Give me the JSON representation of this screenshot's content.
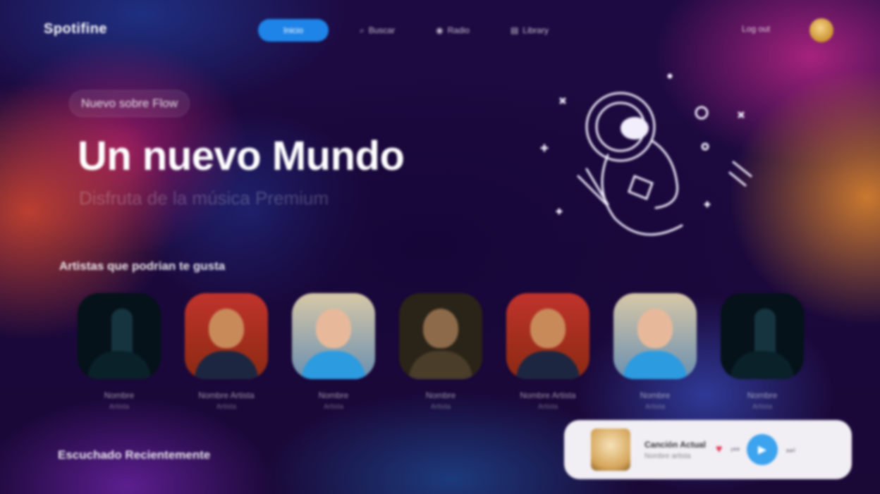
{
  "brand": {
    "logo": "Spotifine"
  },
  "nav": {
    "items": [
      {
        "label": "Inicio",
        "icon": "home-icon",
        "glyph": "",
        "active": true
      },
      {
        "label": "Buscar",
        "icon": "search-icon",
        "glyph": "⌕",
        "active": false
      },
      {
        "label": "Radio",
        "icon": "radio-icon",
        "glyph": "◉",
        "active": false
      },
      {
        "label": "Library",
        "icon": "library-icon",
        "glyph": "▤",
        "active": false
      }
    ],
    "login": "Log out"
  },
  "hero": {
    "badge": "Nuevo sobre Flow",
    "title": "Un nuevo Mundo",
    "subtitle": "Disfruta de la música Premium"
  },
  "artists_section": {
    "title": "Artistas que podrian te gusta",
    "artists": [
      {
        "name": "Nombre",
        "role": "Artista",
        "style": "p1"
      },
      {
        "name": "Nombre Artista",
        "role": "Artista",
        "style": "p2"
      },
      {
        "name": "Nombre",
        "role": "Artista",
        "style": "p3"
      },
      {
        "name": "Nombre",
        "role": "Artista",
        "style": "p4"
      },
      {
        "name": "Nombre Artista",
        "role": "Artista",
        "style": "p2"
      },
      {
        "name": "Nombre",
        "role": "Artista",
        "style": "p3"
      },
      {
        "name": "Nombre",
        "role": "Artista",
        "style": "p1"
      }
    ]
  },
  "recent_section": {
    "title": "Escuchado Recientemente"
  },
  "player": {
    "song": "Canción Actual",
    "artist": "Nombre artista",
    "heart_icon": "heart-icon",
    "prev_icon": "previous-icon",
    "play_icon": "play-icon",
    "next_icon": "next-icon"
  },
  "colors": {
    "accent": "#1e84e8",
    "player_bg": "#f1eef4",
    "heart": "#e23b56",
    "play": "#3ca3ee"
  }
}
